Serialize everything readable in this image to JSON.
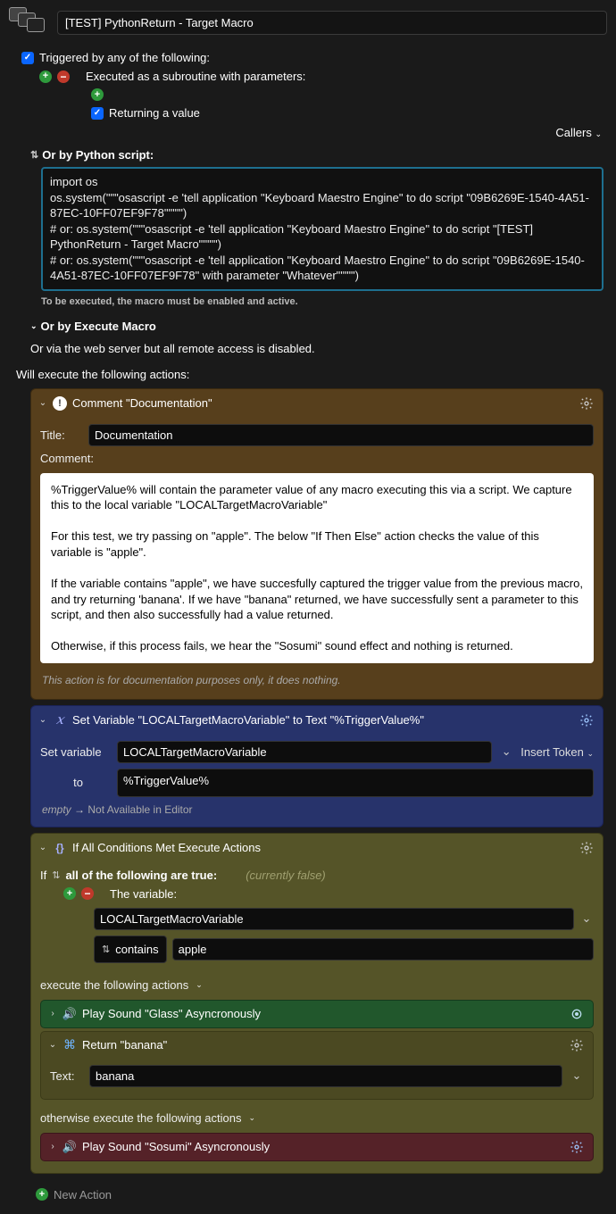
{
  "header": {
    "title": "[TEST] PythonReturn - Target Macro"
  },
  "trigger": {
    "heading": "Triggered by any of the following:",
    "subroutine": "Executed as a subroutine with parameters:",
    "returning": "Returning a value",
    "callers": "Callers",
    "python_label": "Or by Python script:",
    "script": "import os\nos.system(\"\"\"osascript -e 'tell application \"Keyboard Maestro Engine\" to do script \"09B6269E-1540-4A51-87EC-10FF07EF9F78\"'\"\"\")\n# or: os.system(\"\"\"osascript -e 'tell application \"Keyboard Maestro Engine\" to do script \"[TEST] PythonReturn - Target Macro\"'\"\"\")\n# or: os.system(\"\"\"osascript -e 'tell application \"Keyboard Maestro Engine\" to do script \"09B6269E-1540-4A51-87EC-10FF07EF9F78\" with parameter \"Whatever\"'\"\"\")",
    "hint": "To be executed, the macro must be enabled and active.",
    "execute_macro": "Or by Execute Macro",
    "via_web": "Or via the web server but all remote access is disabled."
  },
  "actions_heading": "Will execute the following actions:",
  "comment": {
    "title": "Comment \"Documentation\"",
    "title_label": "Title:",
    "title_value": "Documentation",
    "comment_label": "Comment:",
    "body": "%TriggerValue% will contain the parameter value of any macro executing this via a script. We capture this to the local variable \"LOCALTargetMacroVariable\"\n\nFor this test, we try passing on \"apple\". The below \"If Then Else\" action checks the value of this variable is \"apple\".\n\nIf the variable contains \"apple\", we have succesfully captured the trigger value from the previous macro, and try returning 'banana'. If we have \"banana\" returned, we have successfully sent a parameter to this script, and then also successfully had a value returned.\n\nOtherwise, if this process fails, we hear the \"Sosumi\" sound effect and nothing is returned.",
    "note": "This action is for documentation purposes only, it does nothing."
  },
  "setvar": {
    "title": "Set Variable \"LOCALTargetMacroVariable\" to Text \"%TriggerValue%\"",
    "label": "Set variable",
    "name": "LOCALTargetMacroVariable",
    "to_label": "to",
    "value": "%TriggerValue%",
    "token": "Insert Token",
    "status_empty": "empty",
    "status_na": "Not Available in Editor"
  },
  "ifthen": {
    "title": "If All Conditions Met Execute Actions",
    "if_label": "If",
    "all_label": "all of the following are true:",
    "currently": "(currently false)",
    "var_label": "The variable:",
    "var_name": "LOCALTargetMacroVariable",
    "op": "contains",
    "value": "apple",
    "exec_label": "execute the following actions",
    "else_label": "otherwise execute the following actions",
    "glass": {
      "title": "Play Sound \"Glass\" Asyncronously"
    },
    "ret": {
      "title": "Return \"banana\"",
      "text_label": "Text:",
      "value": "banana"
    },
    "sosumi": {
      "title": "Play Sound \"Sosumi\" Asyncronously"
    }
  },
  "new_action": "New Action"
}
